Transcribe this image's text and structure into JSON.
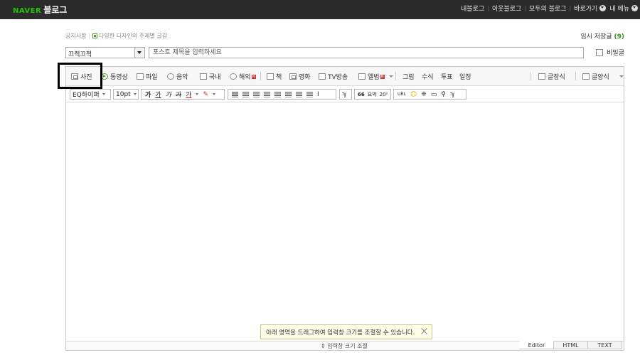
{
  "topbar": {
    "logo_naver": "NAVER",
    "logo_blog": "블로그",
    "nav": [
      "내블로그",
      "이웃블로그",
      "모두의 블로그",
      "바로가기",
      "내 메뉴"
    ]
  },
  "notice": {
    "label": "공지사항",
    "text": "다양한 디자인의 주제별 글감"
  },
  "tempsave": {
    "label": "임시 저장글",
    "count": "(9)"
  },
  "category": {
    "value": "끄적끄적"
  },
  "title": {
    "placeholder": "포스트 제목을 입력하세요"
  },
  "secret": {
    "label": "비밀글"
  },
  "toolbar1": {
    "photo": "사진",
    "video": "동영상",
    "file": "파일",
    "music": "음악",
    "domestic": "국내",
    "overseas": "해외",
    "book": "책",
    "movie": "영화",
    "tv": "TV방송",
    "album": "앨범",
    "draw": "그림",
    "formula": "수식",
    "vote": "투표",
    "schedule": "일정",
    "writestyle": "글장식",
    "template": "글양식"
  },
  "toolbar2": {
    "font": "EQ하이퍼",
    "size": "10pt",
    "bold": "가",
    "italic": "가",
    "underline": "가",
    "strike": "가",
    "fontcolor": "가",
    "quote": "66",
    "abbr": "요약",
    "sup": "20²",
    "url": "URL"
  },
  "tooltip": {
    "text": "아래 영역을 드래그하여 입력창 크기를 조절할 수 있습니다."
  },
  "resize": {
    "label": "⇕ 입력창 크기 조절"
  },
  "modes": [
    "Editor",
    "HTML",
    "TEXT"
  ]
}
